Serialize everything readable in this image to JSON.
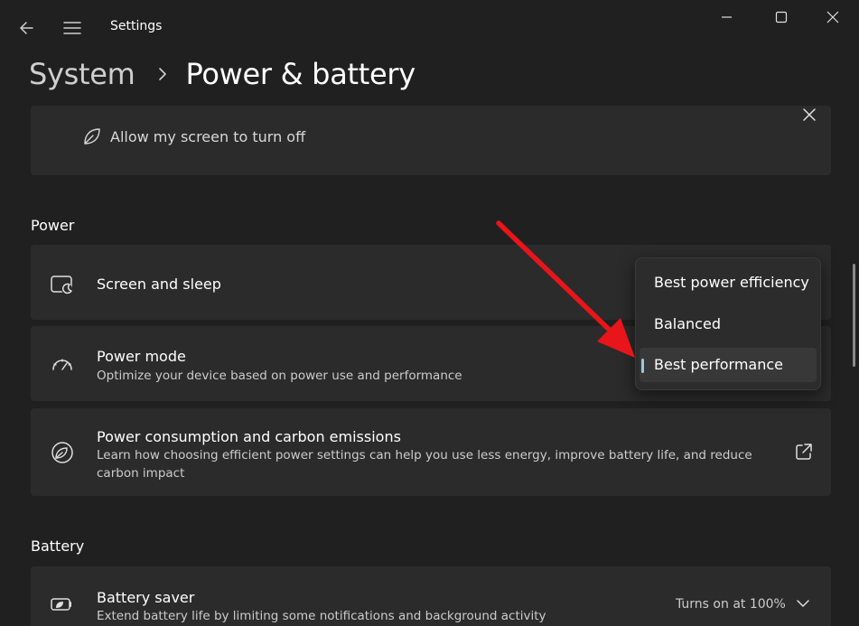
{
  "window": {
    "title": "Settings"
  },
  "breadcrumb": {
    "parent": "System",
    "current": "Power & battery"
  },
  "screen_card": {
    "label": "Allow my screen to turn off"
  },
  "sections": {
    "power": "Power",
    "battery": "Battery"
  },
  "power_items": {
    "screen_sleep": {
      "title": "Screen and sleep"
    },
    "power_mode": {
      "title": "Power mode",
      "description": "Optimize your device based on power use and performance"
    },
    "carbon": {
      "title": "Power consumption and carbon emissions",
      "description_line1": "Learn how choosing efficient power settings can help you use less energy, improve battery life, and reduce",
      "description_line2": "carbon impact"
    }
  },
  "power_mode_dropdown": {
    "options": [
      "Best power efficiency",
      "Balanced",
      "Best performance"
    ],
    "selected": "Best performance"
  },
  "battery_items": {
    "saver": {
      "title": "Battery saver",
      "description": "Extend battery life by limiting some notifications and background activity",
      "status": "Turns on at 100%"
    }
  },
  "colors": {
    "background": "#202020",
    "card": "#2b2b2b",
    "accent": "#9ac7e6",
    "annotation_arrow": "#e8151b"
  },
  "icons": {
    "back": "back-arrow-icon",
    "menu": "hamburger-menu-icon",
    "minimize": "minimize-icon",
    "maximize": "maximize-icon",
    "close": "close-icon",
    "leaf": "leaf-icon",
    "screen_sleep": "screen-sleep-icon",
    "power_mode": "gauge-icon",
    "carbon": "leaf-icon",
    "external_link": "external-link-icon",
    "battery_saver": "battery-saver-icon",
    "chevron": "chevron-down-icon"
  }
}
